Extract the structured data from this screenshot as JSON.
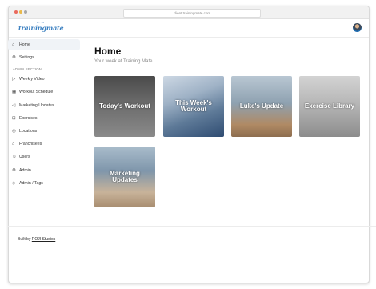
{
  "browser": {
    "url": "client.trainingmate.com"
  },
  "app": {
    "logo_text": "trainingmate",
    "brand_color": "#3a7fc0"
  },
  "sidebar": {
    "items": [
      {
        "label": "Home",
        "icon": "home-icon",
        "glyph": "⌂"
      },
      {
        "label": "Settings",
        "icon": "gear-icon",
        "glyph": "⚙"
      }
    ],
    "admin_section_label": "ADMIN SECTION",
    "admin_items": [
      {
        "label": "Weekly Video",
        "icon": "video-icon",
        "glyph": "▷"
      },
      {
        "label": "Workout Schedule",
        "icon": "calendar-icon",
        "glyph": "▦"
      },
      {
        "label": "Marketing Updates",
        "icon": "megaphone-icon",
        "glyph": "◁"
      },
      {
        "label": "Exercises",
        "icon": "dumbbell-icon",
        "glyph": "⊞"
      },
      {
        "label": "Locations",
        "icon": "location-icon",
        "glyph": "◎"
      },
      {
        "label": "Franchisees",
        "icon": "building-icon",
        "glyph": "⌂"
      },
      {
        "label": "Users",
        "icon": "users-icon",
        "glyph": "☺"
      },
      {
        "label": "Admin",
        "icon": "admin-icon",
        "glyph": "⚙"
      },
      {
        "label": "Admin / Tags",
        "icon": "tag-icon",
        "glyph": "◇"
      }
    ]
  },
  "main": {
    "title": "Home",
    "subtitle": "Your week at Training Mate.",
    "tiles": [
      {
        "label": "Today's Workout"
      },
      {
        "label": "This Week's Workout"
      },
      {
        "label": "Luke's Update"
      },
      {
        "label": "Exercise Library"
      },
      {
        "label": "Marketing Updates"
      }
    ]
  },
  "footer": {
    "prefix": "Built by",
    "link": "ROJI Studios"
  }
}
